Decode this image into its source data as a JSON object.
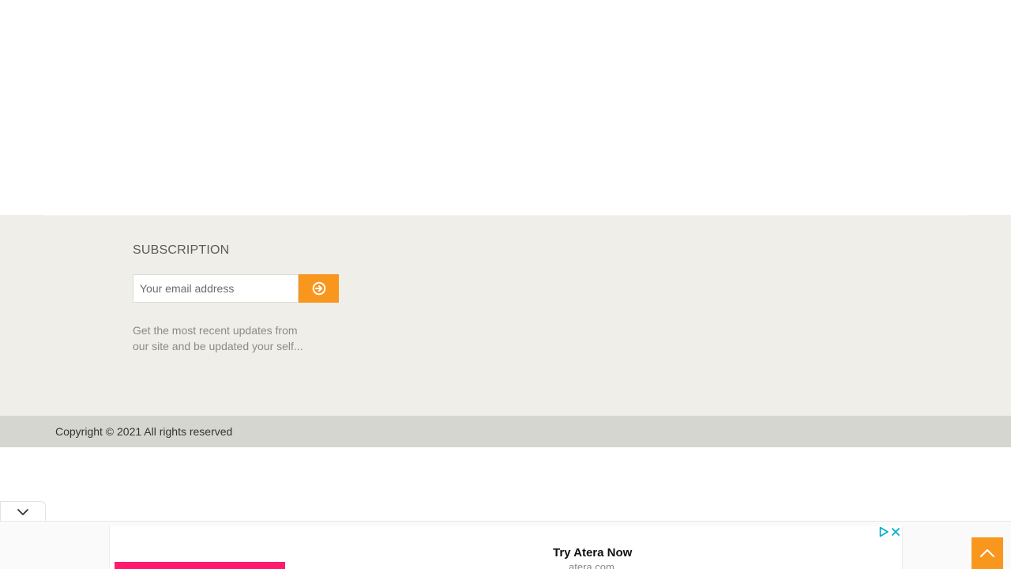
{
  "subscription": {
    "title": "SUBSCRIPTION",
    "email_placeholder": "Your email address",
    "submit_icon": "circle-arrow-right-icon",
    "description": "Get the most recent updates from our site and be updated your self..."
  },
  "footer": {
    "copyright": "Copyright © 2021 All rights reserved"
  },
  "ad": {
    "title": "Try Atera Now",
    "domain": "atera.com",
    "choices_icon": "adchoices-play-icon",
    "close_icon": "close-icon",
    "collapse_icon": "chevron-down-icon"
  },
  "scroll_top": {
    "icon": "chevron-up-icon"
  },
  "colors": {
    "accent": "#f8961e",
    "footer_bg": "#efeee8",
    "copyright_bg": "#d6d6d1",
    "ad_image": "#ff1b6d",
    "ad_icon": "#00aecd"
  }
}
